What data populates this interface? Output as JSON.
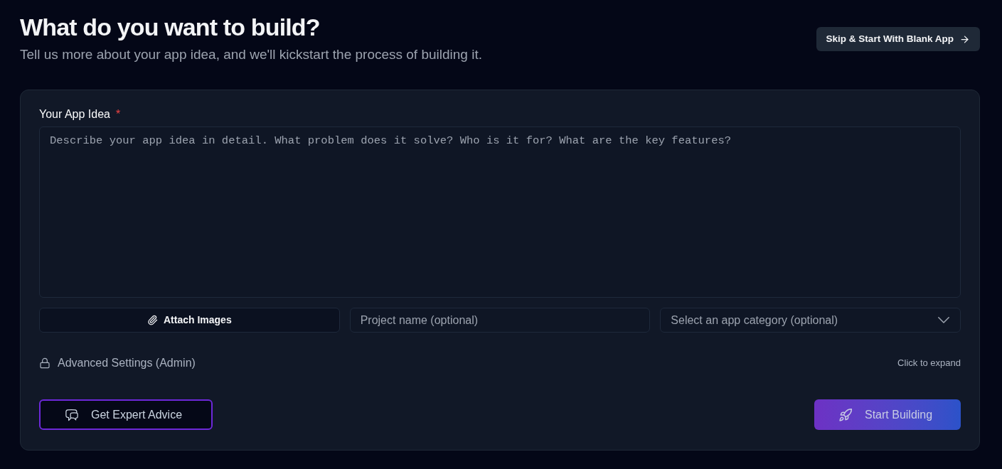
{
  "header": {
    "title": "What do you want to build?",
    "subtitle": "Tell us more about your app idea, and we'll kickstart the process of building it.",
    "skip_button": "Skip & Start With Blank App"
  },
  "form": {
    "idea_label": "Your App Idea",
    "required_mark": "*",
    "idea": {
      "placeholder": "Describe your app idea in detail. What problem does it solve? Who is it for? What are the key features?"
    },
    "attach_button": "Attach Images",
    "project_name": {
      "placeholder": "Project name (optional)"
    },
    "category_select": {
      "placeholder": "Select an app category (optional)"
    },
    "advanced_settings": {
      "label": "Advanced Settings (Admin)",
      "hint": "Click to expand"
    },
    "expert_button": "Get Expert Advice",
    "start_button": {
      "label": "Start Building",
      "disabled": true
    }
  }
}
